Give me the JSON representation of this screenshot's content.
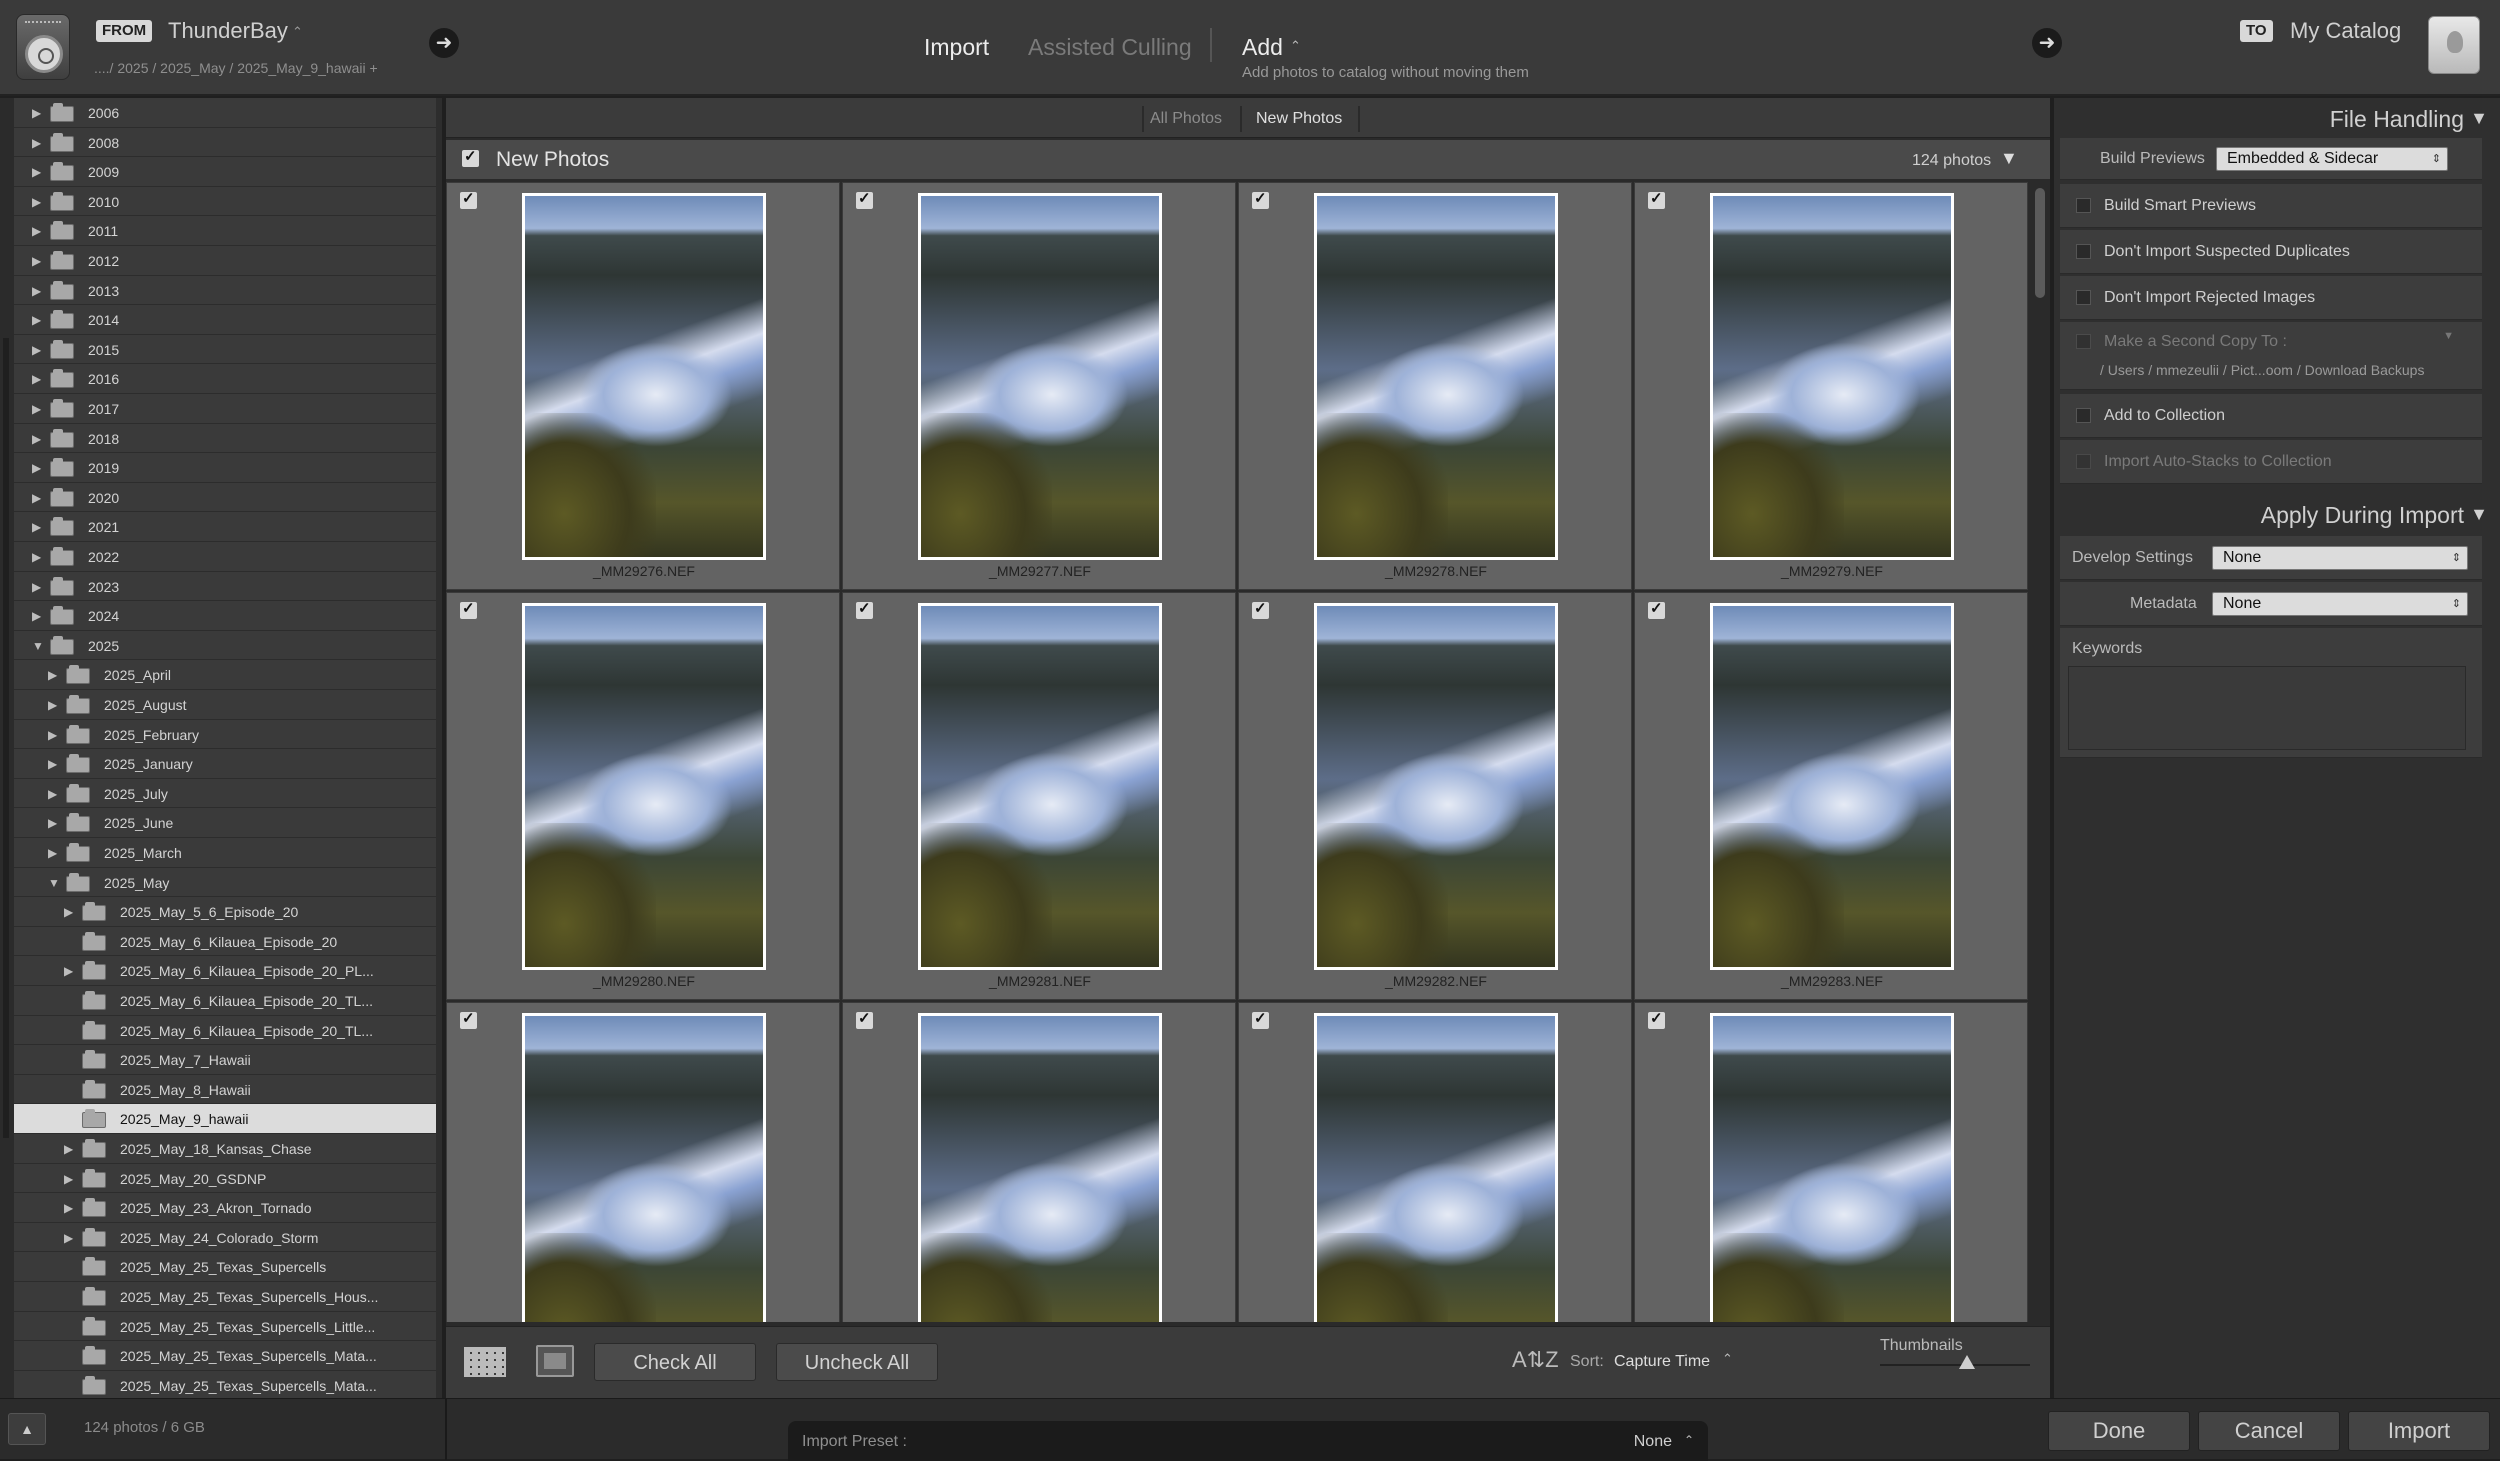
{
  "topbar": {
    "from_tag": "FROM",
    "source_name": "ThunderBay",
    "source_arrow": "⌃",
    "source_path": "..../ 2025 / 2025_May / 2025_May_9_hawaii +",
    "modes": [
      "Import",
      "Assisted Culling"
    ],
    "add_label": "Add",
    "add_subtitle": "Add photos to catalog without moving them",
    "to_tag": "TO",
    "catalog_name": "My Catalog"
  },
  "folders": [
    {
      "label": "2006",
      "depth": 0,
      "expanded": false
    },
    {
      "label": "2008",
      "depth": 0,
      "expanded": false
    },
    {
      "label": "2009",
      "depth": 0,
      "expanded": false
    },
    {
      "label": "2010",
      "depth": 0,
      "expanded": false
    },
    {
      "label": "2011",
      "depth": 0,
      "expanded": false
    },
    {
      "label": "2012",
      "depth": 0,
      "expanded": false
    },
    {
      "label": "2013",
      "depth": 0,
      "expanded": false
    },
    {
      "label": "2014",
      "depth": 0,
      "expanded": false
    },
    {
      "label": "2015",
      "depth": 0,
      "expanded": false
    },
    {
      "label": "2016",
      "depth": 0,
      "expanded": false
    },
    {
      "label": "2017",
      "depth": 0,
      "expanded": false
    },
    {
      "label": "2018",
      "depth": 0,
      "expanded": false
    },
    {
      "label": "2019",
      "depth": 0,
      "expanded": false
    },
    {
      "label": "2020",
      "depth": 0,
      "expanded": false
    },
    {
      "label": "2021",
      "depth": 0,
      "expanded": false
    },
    {
      "label": "2022",
      "depth": 0,
      "expanded": false
    },
    {
      "label": "2023",
      "depth": 0,
      "expanded": false
    },
    {
      "label": "2024",
      "depth": 0,
      "expanded": false
    },
    {
      "label": "2025",
      "depth": 0,
      "expanded": true
    },
    {
      "label": "2025_April",
      "depth": 1,
      "expanded": false
    },
    {
      "label": "2025_August",
      "depth": 1,
      "expanded": false
    },
    {
      "label": "2025_February",
      "depth": 1,
      "expanded": false
    },
    {
      "label": "2025_January",
      "depth": 1,
      "expanded": false
    },
    {
      "label": "2025_July",
      "depth": 1,
      "expanded": false
    },
    {
      "label": "2025_June",
      "depth": 1,
      "expanded": false
    },
    {
      "label": "2025_March",
      "depth": 1,
      "expanded": false
    },
    {
      "label": "2025_May",
      "depth": 1,
      "expanded": true
    },
    {
      "label": "2025_May_5_6_Episode_20",
      "depth": 2,
      "expanded": false
    },
    {
      "label": "2025_May_6_Kilauea_Episode_20",
      "depth": 2,
      "expanded": null
    },
    {
      "label": "2025_May_6_Kilauea_Episode_20_PL...",
      "depth": 2,
      "expanded": false
    },
    {
      "label": "2025_May_6_Kilauea_Episode_20_TL...",
      "depth": 2,
      "expanded": null
    },
    {
      "label": "2025_May_6_Kilauea_Episode_20_TL...",
      "depth": 2,
      "expanded": null
    },
    {
      "label": "2025_May_7_Hawaii",
      "depth": 2,
      "expanded": null
    },
    {
      "label": "2025_May_8_Hawaii",
      "depth": 2,
      "expanded": null
    },
    {
      "label": "2025_May_9_hawaii",
      "depth": 2,
      "expanded": null,
      "selected": true
    },
    {
      "label": "2025_May_18_Kansas_Chase",
      "depth": 2,
      "expanded": false
    },
    {
      "label": "2025_May_20_GSDNP",
      "depth": 2,
      "expanded": false
    },
    {
      "label": "2025_May_23_Akron_Tornado",
      "depth": 2,
      "expanded": false
    },
    {
      "label": "2025_May_24_Colorado_Storm",
      "depth": 2,
      "expanded": false
    },
    {
      "label": "2025_May_25_Texas_Supercells",
      "depth": 2,
      "expanded": null
    },
    {
      "label": "2025_May_25_Texas_Supercells_Hous...",
      "depth": 2,
      "expanded": null
    },
    {
      "label": "2025_May_25_Texas_Supercells_Little...",
      "depth": 2,
      "expanded": null
    },
    {
      "label": "2025_May_25_Texas_Supercells_Mata...",
      "depth": 2,
      "expanded": null
    },
    {
      "label": "2025_May_25_Texas_Supercells_Mata...",
      "depth": 2,
      "expanded": null
    }
  ],
  "center": {
    "tabs": [
      "All Photos",
      "New Photos"
    ],
    "active_tab": 1,
    "header_title": "New Photos",
    "header_count": "124 photos",
    "photos": [
      "_MM29276.NEF",
      "_MM29277.NEF",
      "_MM29278.NEF",
      "_MM29279.NEF",
      "_MM29280.NEF",
      "_MM29281.NEF",
      "_MM29282.NEF",
      "_MM29283.NEF",
      "",
      "",
      "",
      ""
    ]
  },
  "toolbar": {
    "check_all": "Check All",
    "uncheck_all": "Uncheck All",
    "sort_icon": "A⇅Z",
    "sort_label": "Sort:",
    "sort_value": "Capture Time",
    "sort_arrows": "⌃",
    "thumbnails_label": "Thumbnails",
    "thumbnail_size": 0.58
  },
  "right": {
    "file_handling_title": "File Handling",
    "build_previews_label": "Build Previews",
    "build_previews_value": "Embedded & Sidecar",
    "options": [
      {
        "label": "Build Smart Previews",
        "enabled": true
      },
      {
        "label": "Don't Import Suspected Duplicates",
        "enabled": true
      },
      {
        "label": "Don't Import Rejected Images",
        "enabled": true
      }
    ],
    "second_copy_label": "Make a Second Copy To :",
    "second_copy_path": "/ Users / mmezeulii / Pict...oom / Download Backups",
    "add_to_collection": "Add to Collection",
    "auto_stacks": "Import Auto-Stacks to Collection",
    "apply_title": "Apply During Import",
    "develop_label": "Develop Settings",
    "develop_value": "None",
    "metadata_label": "Metadata",
    "metadata_value": "None",
    "keywords_label": "Keywords"
  },
  "bottombar": {
    "count_size": "124 photos / 6 GB",
    "preset_label": "Import Preset :",
    "preset_value": "None",
    "preset_arrows": "⌃",
    "done": "Done",
    "cancel": "Cancel",
    "import": "Import"
  }
}
